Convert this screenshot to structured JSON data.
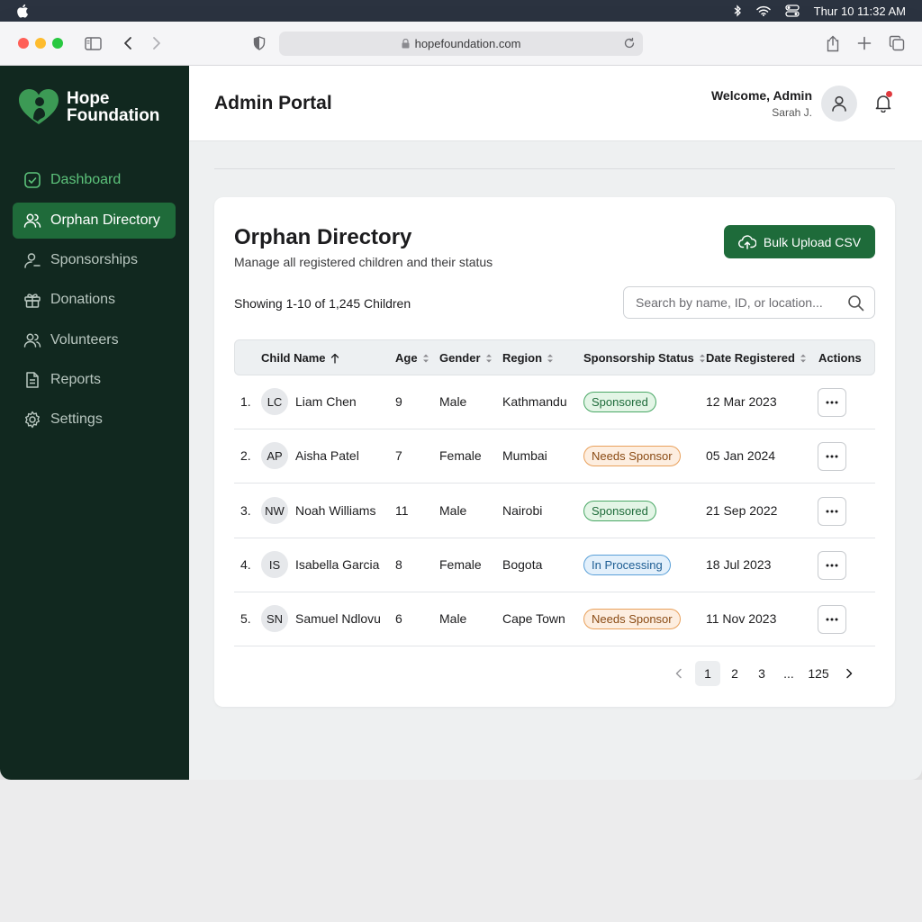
{
  "menubar": {
    "clock": "Thur 10  11:32 AM"
  },
  "browser": {
    "url": "hopefoundation.com"
  },
  "sidebar": {
    "brand_line1": "Hope",
    "brand_line2": "Foundation",
    "items": [
      {
        "label": "Dashboard",
        "icon": "dashboard-icon"
      },
      {
        "label": "Orphan Directory",
        "icon": "users-icon"
      },
      {
        "label": "Sponsorships",
        "icon": "sponsor-icon"
      },
      {
        "label": "Donations",
        "icon": "gift-icon"
      },
      {
        "label": "Volunteers",
        "icon": "volunteers-icon"
      },
      {
        "label": "Reports",
        "icon": "document-icon"
      },
      {
        "label": "Settings",
        "icon": "gear-icon"
      }
    ]
  },
  "header": {
    "title": "Admin Portal",
    "welcome": "Welcome, Admin",
    "user": "Sarah J."
  },
  "directory": {
    "title": "Orphan Directory",
    "subtitle": "Manage all registered children and their status",
    "upload_label": "Bulk Upload CSV",
    "showing": "Showing 1-10 of 1,245 Children",
    "search_placeholder": "Search by name, ID, or location...",
    "columns": [
      "Child Name",
      "Age",
      "Gender",
      "Region",
      "Sponsorship Status",
      "Date Registered",
      "Actions"
    ],
    "rows": [
      {
        "num": "1.",
        "initials": "LC",
        "name": "Liam Chen",
        "age": "9",
        "gender": "Male",
        "region": "Kathmandu",
        "status": "Sponsored",
        "date": "12 Mar 2023"
      },
      {
        "num": "2.",
        "initials": "AP",
        "name": "Aisha Patel",
        "age": "7",
        "gender": "Female",
        "region": "Mumbai",
        "status": "Needs Sponsor",
        "date": "05 Jan 2024"
      },
      {
        "num": "3.",
        "initials": "NW",
        "name": "Noah Williams",
        "age": "11",
        "gender": "Male",
        "region": "Nairobi",
        "status": "Sponsored",
        "date": "21 Sep 2022"
      },
      {
        "num": "4.",
        "initials": "IS",
        "name": "Isabella Garcia",
        "age": "8",
        "gender": "Female",
        "region": "Bogota",
        "status": "In Processing",
        "date": "18 Jul 2023"
      },
      {
        "num": "5.",
        "initials": "SN",
        "name": "Samuel Ndlovu",
        "age": "6",
        "gender": "Male",
        "region": "Cape Town",
        "status": "Needs Sponsor",
        "date": "11 Nov 2023"
      }
    ],
    "pagination": {
      "pages": [
        "1",
        "2",
        "3",
        "...",
        "125"
      ],
      "current": "1"
    }
  },
  "colors": {
    "sidebar_bg": "#11281f",
    "accent_green": "#1e6b3a",
    "status_sponsored": "#4aa866",
    "status_needs_sponsor": "#e9a15c",
    "status_processing": "#5aa0d8"
  }
}
